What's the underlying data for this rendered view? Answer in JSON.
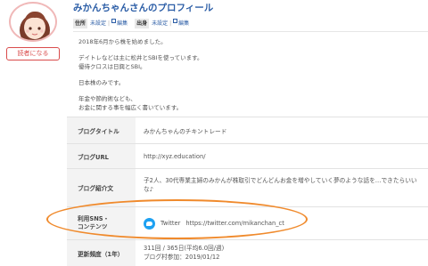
{
  "profile": {
    "title": "みかんちゃんさんのプロフィール",
    "reader_button": "読者になる"
  },
  "meta": {
    "residence_key": "住所",
    "residence_val": "未設定",
    "origin_key": "出身",
    "origin_val": "未設定",
    "edit_label": "編集",
    "separator": "|"
  },
  "bio": {
    "lines": [
      "2018年6月から株を始めました。",
      "",
      "デイトレなどは主に松井とSBIを使っています。",
      "優待クロスは日興とSBI。",
      "",
      "日本株のみです。",
      "",
      "年金や節約術なども、",
      "お金に関する事を幅広く書いています。"
    ]
  },
  "table": {
    "blog_title_key": "ブログタイトル",
    "blog_title_val": "みかんちゃんのチキントレード",
    "blog_url_key": "ブログURL",
    "blog_url_val": "http://xyz.education/",
    "intro_key": "ブログ紹介文",
    "intro_val": "子2人、30代専業主婦のみかんが株取引でどんどんお金を増やしていく夢のような話を…できたらいいな♪",
    "sns_key_line1": "利用SNS・",
    "sns_key_line2": "コンテンツ",
    "sns_service": "Twitter",
    "sns_url": "https://twitter.com/mikanchan_ct",
    "freq_key": "更新頻度（1年）",
    "freq_line1": "311回 / 365日(平均6.0回/週)",
    "freq_line2": "ブログ村参加：2019/01/12"
  },
  "colors": {
    "accent": "#2b5da6",
    "reader_button": "#d94b4b",
    "highlight": "#f08a2c",
    "twitter": "#1da1f2"
  }
}
